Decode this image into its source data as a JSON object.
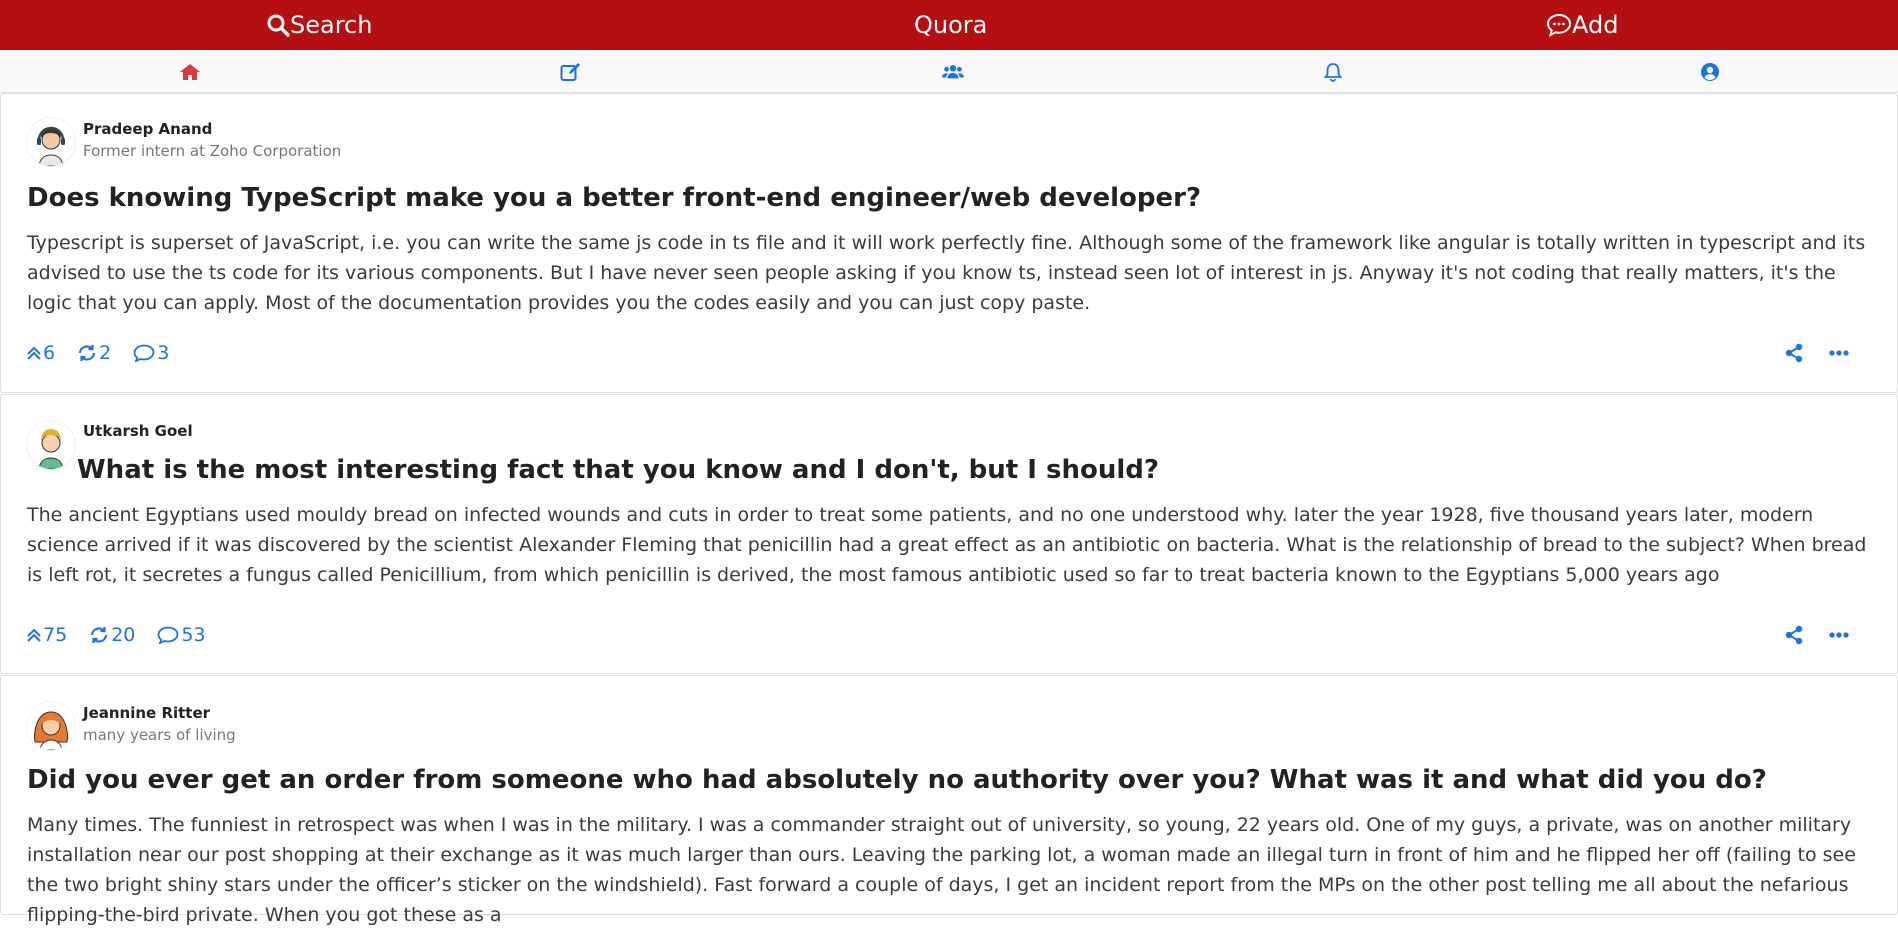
{
  "topbar": {
    "search_label": "Search",
    "brand": "Quora",
    "add_label": "Add",
    "bg_color": "#b50f11"
  },
  "nav": {
    "icons": [
      "home-icon",
      "edit-icon",
      "users-icon",
      "bell-icon",
      "user-circle-icon"
    ],
    "accent": "#e0373a",
    "link_color": "#1a73e8"
  },
  "posts": [
    {
      "author": "Pradeep Anand",
      "credential": "Former intern at Zoho Corporation",
      "question": "Does knowing TypeScript make you a better front-end engineer/web developer?",
      "answer": "Typescript is superset of JavaScript, i.e. you can write the same js code in ts file and it will work perfectly fine. Although some of the framework like angular is totally written in typescript and its advised to use the ts code for its various components. But I have never seen people asking if you know ts, instead seen lot of interest in js. Anyway it's not coding that really matters, it's the logic that you can apply. Most of the documentation provides you the codes easily and you can just copy paste.",
      "upvotes": "6",
      "shares": "2",
      "comments": "3"
    },
    {
      "author": "Utkarsh Goel",
      "credential": "",
      "question": "What is the most interesting fact that you know and I don't, but I should?",
      "answer": "The ancient Egyptians used mouldy bread on infected wounds and cuts in order to treat some patients, and no one understood why. later the year 1928, five thousand years later, modern science arrived if it was discovered by the scientist Alexander Fleming that penicillin had a great effect as an antibiotic on bacteria. What is the relationship of bread to the subject? When bread is left rot, it secretes a fungus called Penicillium, from which penicillin is derived, the most famous antibiotic used so far to treat bacteria known to the Egyptians 5,000 years ago",
      "upvotes": "75",
      "shares": "20",
      "comments": "53"
    },
    {
      "author": "Jeannine Ritter",
      "credential": "many years of living",
      "question": "Did you ever get an order from someone who had absolutely no authority over you? What was it and what did you do?",
      "answer": "Many times. The funniest in retrospect was when I was in the military. I was a commander straight out of university, so young, 22 years old. One of my guys, a private, was on another military installation near our post shopping at their exchange as it was much larger than ours. Leaving the parking lot, a woman made an illegal turn in front of him and he flipped her off (failing to see the two bright shiny stars under the officer’s sticker on the windshield). Fast forward a couple of days, I get an incident report from the MPs on the other post telling me all about the nefarious flipping-the-bird private. When you got these as a"
    }
  ]
}
